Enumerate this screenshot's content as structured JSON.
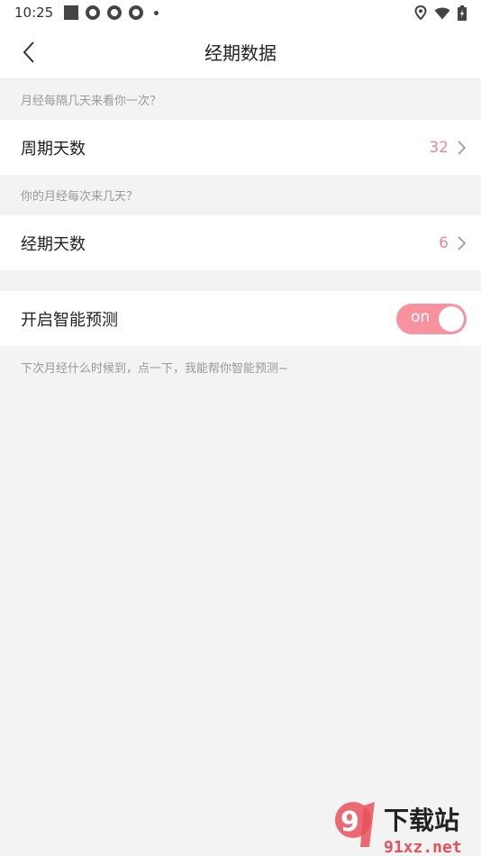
{
  "status_bar": {
    "time": "10:25"
  },
  "nav": {
    "title": "经期数据"
  },
  "cycle": {
    "hint": "月经每隔几天来看你一次？",
    "label": "周期天数",
    "value": "32"
  },
  "period": {
    "hint": "你的月经每次来几天？",
    "label": "经期天数",
    "value": "6"
  },
  "prediction": {
    "label": "开启智能预测",
    "toggle_label": "on",
    "enabled": true,
    "note": "下次月经什么时候到，点一下，我能帮你智能预测~"
  },
  "watermark": {
    "brand": "下载站",
    "site": "91xz.net"
  },
  "colors": {
    "accent": "#f08596",
    "toggle_on": "#f8929f",
    "background": "#f3f3f3"
  }
}
